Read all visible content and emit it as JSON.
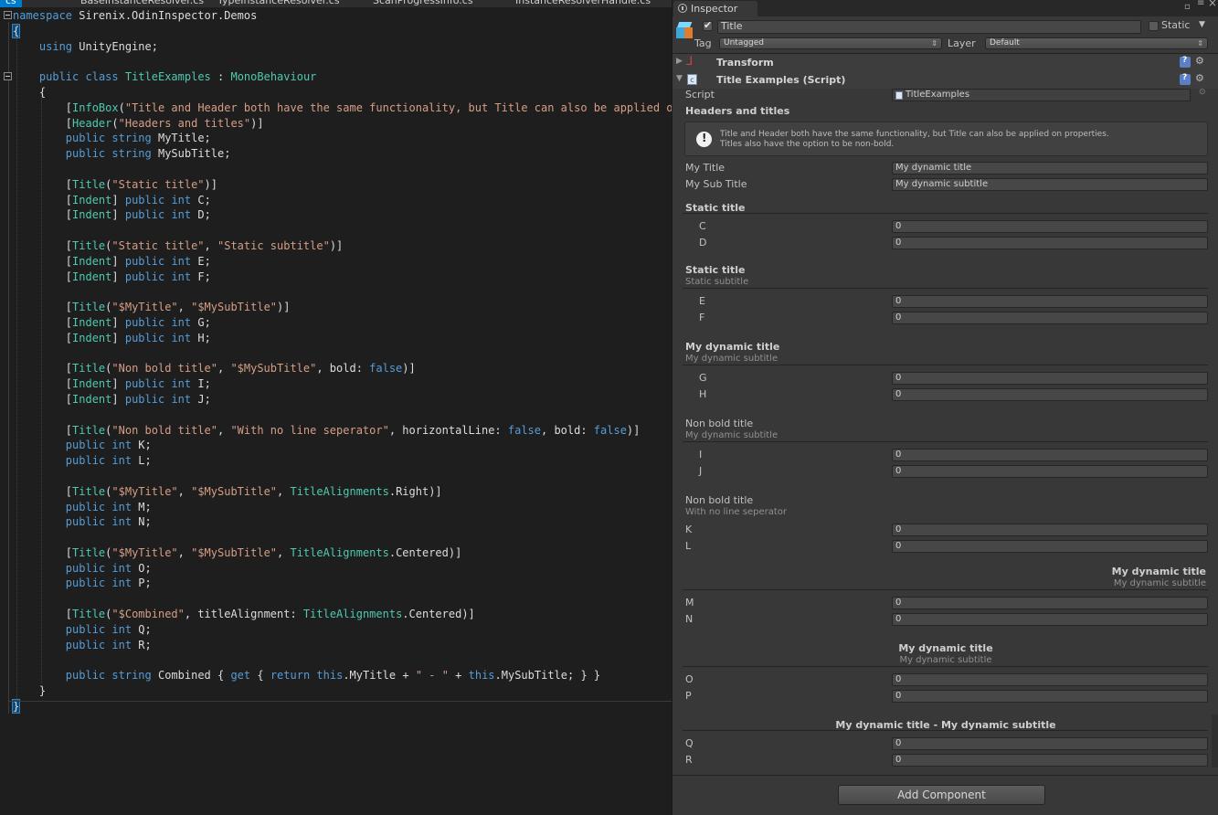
{
  "editor": {
    "tabs": [
      "cs",
      "BaseInstanceResolver.cs",
      "TypeInstanceResolver.cs",
      "ScanProgressInfo.cs",
      "InstanceResolverHandle.cs"
    ],
    "lines": [
      [
        [
          "kw",
          "namespace"
        ],
        [
          "pl",
          " Sirenix.OdinInspector.Demos"
        ]
      ],
      [
        [
          "pl",
          "{"
        ]
      ],
      [
        [
          "pl",
          "    "
        ],
        [
          "kw",
          "using"
        ],
        [
          "pl",
          " UnityEngine;"
        ]
      ],
      [
        [
          "pl",
          ""
        ]
      ],
      [
        [
          "pl",
          "    "
        ],
        [
          "kw",
          "public"
        ],
        [
          "pl",
          " "
        ],
        [
          "kw",
          "class"
        ],
        [
          "pl",
          " "
        ],
        [
          "ty",
          "TitleExamples"
        ],
        [
          "pl",
          " : "
        ],
        [
          "ty",
          "MonoBehaviour"
        ]
      ],
      [
        [
          "pl",
          "    {"
        ]
      ],
      [
        [
          "pl",
          "        ["
        ],
        [
          "ty",
          "InfoBox"
        ],
        [
          "pl",
          "("
        ],
        [
          "st",
          "\"Title and Header both have the same functionality, but Title can also be applied on"
        ]
      ],
      [
        [
          "pl",
          "        ["
        ],
        [
          "ty",
          "Header"
        ],
        [
          "pl",
          "("
        ],
        [
          "st",
          "\"Headers and titles\""
        ],
        [
          "pl",
          ")]"
        ]
      ],
      [
        [
          "pl",
          "        "
        ],
        [
          "kw",
          "public"
        ],
        [
          "pl",
          " "
        ],
        [
          "kw",
          "string"
        ],
        [
          "pl",
          " MyTitle;"
        ]
      ],
      [
        [
          "pl",
          "        "
        ],
        [
          "kw",
          "public"
        ],
        [
          "pl",
          " "
        ],
        [
          "kw",
          "string"
        ],
        [
          "pl",
          " MySubTitle;"
        ]
      ],
      [
        [
          "pl",
          ""
        ]
      ],
      [
        [
          "pl",
          "        ["
        ],
        [
          "ty",
          "Title"
        ],
        [
          "pl",
          "("
        ],
        [
          "st",
          "\"Static title\""
        ],
        [
          "pl",
          ")]"
        ]
      ],
      [
        [
          "pl",
          "        ["
        ],
        [
          "ty",
          "Indent"
        ],
        [
          "pl",
          "] "
        ],
        [
          "kw",
          "public"
        ],
        [
          "pl",
          " "
        ],
        [
          "kw",
          "int"
        ],
        [
          "pl",
          " C;"
        ]
      ],
      [
        [
          "pl",
          "        ["
        ],
        [
          "ty",
          "Indent"
        ],
        [
          "pl",
          "] "
        ],
        [
          "kw",
          "public"
        ],
        [
          "pl",
          " "
        ],
        [
          "kw",
          "int"
        ],
        [
          "pl",
          " D;"
        ]
      ],
      [
        [
          "pl",
          ""
        ]
      ],
      [
        [
          "pl",
          "        ["
        ],
        [
          "ty",
          "Title"
        ],
        [
          "pl",
          "("
        ],
        [
          "st",
          "\"Static title\""
        ],
        [
          "pl",
          ", "
        ],
        [
          "st",
          "\"Static subtitle\""
        ],
        [
          "pl",
          ")]"
        ]
      ],
      [
        [
          "pl",
          "        ["
        ],
        [
          "ty",
          "Indent"
        ],
        [
          "pl",
          "] "
        ],
        [
          "kw",
          "public"
        ],
        [
          "pl",
          " "
        ],
        [
          "kw",
          "int"
        ],
        [
          "pl",
          " E;"
        ]
      ],
      [
        [
          "pl",
          "        ["
        ],
        [
          "ty",
          "Indent"
        ],
        [
          "pl",
          "] "
        ],
        [
          "kw",
          "public"
        ],
        [
          "pl",
          " "
        ],
        [
          "kw",
          "int"
        ],
        [
          "pl",
          " F;"
        ]
      ],
      [
        [
          "pl",
          ""
        ]
      ],
      [
        [
          "pl",
          "        ["
        ],
        [
          "ty",
          "Title"
        ],
        [
          "pl",
          "("
        ],
        [
          "st",
          "\"$MyTitle\""
        ],
        [
          "pl",
          ", "
        ],
        [
          "st",
          "\"$MySubTitle\""
        ],
        [
          "pl",
          ")]"
        ]
      ],
      [
        [
          "pl",
          "        ["
        ],
        [
          "ty",
          "Indent"
        ],
        [
          "pl",
          "] "
        ],
        [
          "kw",
          "public"
        ],
        [
          "pl",
          " "
        ],
        [
          "kw",
          "int"
        ],
        [
          "pl",
          " G;"
        ]
      ],
      [
        [
          "pl",
          "        ["
        ],
        [
          "ty",
          "Indent"
        ],
        [
          "pl",
          "] "
        ],
        [
          "kw",
          "public"
        ],
        [
          "pl",
          " "
        ],
        [
          "kw",
          "int"
        ],
        [
          "pl",
          " H;"
        ]
      ],
      [
        [
          "pl",
          ""
        ]
      ],
      [
        [
          "pl",
          "        ["
        ],
        [
          "ty",
          "Title"
        ],
        [
          "pl",
          "("
        ],
        [
          "st",
          "\"Non bold title\""
        ],
        [
          "pl",
          ", "
        ],
        [
          "st",
          "\"$MySubTitle\""
        ],
        [
          "pl",
          ", bold: "
        ],
        [
          "kw",
          "false"
        ],
        [
          "pl",
          ")]"
        ]
      ],
      [
        [
          "pl",
          "        ["
        ],
        [
          "ty",
          "Indent"
        ],
        [
          "pl",
          "] "
        ],
        [
          "kw",
          "public"
        ],
        [
          "pl",
          " "
        ],
        [
          "kw",
          "int"
        ],
        [
          "pl",
          " I;"
        ]
      ],
      [
        [
          "pl",
          "        ["
        ],
        [
          "ty",
          "Indent"
        ],
        [
          "pl",
          "] "
        ],
        [
          "kw",
          "public"
        ],
        [
          "pl",
          " "
        ],
        [
          "kw",
          "int"
        ],
        [
          "pl",
          " J;"
        ]
      ],
      [
        [
          "pl",
          ""
        ]
      ],
      [
        [
          "pl",
          "        ["
        ],
        [
          "ty",
          "Title"
        ],
        [
          "pl",
          "("
        ],
        [
          "st",
          "\"Non bold title\""
        ],
        [
          "pl",
          ", "
        ],
        [
          "st",
          "\"With no line seperator\""
        ],
        [
          "pl",
          ", horizontalLine: "
        ],
        [
          "kw",
          "false"
        ],
        [
          "pl",
          ", bold: "
        ],
        [
          "kw",
          "false"
        ],
        [
          "pl",
          ")]"
        ]
      ],
      [
        [
          "pl",
          "        "
        ],
        [
          "kw",
          "public"
        ],
        [
          "pl",
          " "
        ],
        [
          "kw",
          "int"
        ],
        [
          "pl",
          " K;"
        ]
      ],
      [
        [
          "pl",
          "        "
        ],
        [
          "kw",
          "public"
        ],
        [
          "pl",
          " "
        ],
        [
          "kw",
          "int"
        ],
        [
          "pl",
          " L;"
        ]
      ],
      [
        [
          "pl",
          ""
        ]
      ],
      [
        [
          "pl",
          "        ["
        ],
        [
          "ty",
          "Title"
        ],
        [
          "pl",
          "("
        ],
        [
          "st",
          "\"$MyTitle\""
        ],
        [
          "pl",
          ", "
        ],
        [
          "st",
          "\"$MySubTitle\""
        ],
        [
          "pl",
          ", "
        ],
        [
          "ty",
          "TitleAlignments"
        ],
        [
          "pl",
          ".Right)]"
        ]
      ],
      [
        [
          "pl",
          "        "
        ],
        [
          "kw",
          "public"
        ],
        [
          "pl",
          " "
        ],
        [
          "kw",
          "int"
        ],
        [
          "pl",
          " M;"
        ]
      ],
      [
        [
          "pl",
          "        "
        ],
        [
          "kw",
          "public"
        ],
        [
          "pl",
          " "
        ],
        [
          "kw",
          "int"
        ],
        [
          "pl",
          " N;"
        ]
      ],
      [
        [
          "pl",
          ""
        ]
      ],
      [
        [
          "pl",
          "        ["
        ],
        [
          "ty",
          "Title"
        ],
        [
          "pl",
          "("
        ],
        [
          "st",
          "\"$MyTitle\""
        ],
        [
          "pl",
          ", "
        ],
        [
          "st",
          "\"$MySubTitle\""
        ],
        [
          "pl",
          ", "
        ],
        [
          "ty",
          "TitleAlignments"
        ],
        [
          "pl",
          ".Centered)]"
        ]
      ],
      [
        [
          "pl",
          "        "
        ],
        [
          "kw",
          "public"
        ],
        [
          "pl",
          " "
        ],
        [
          "kw",
          "int"
        ],
        [
          "pl",
          " O;"
        ]
      ],
      [
        [
          "pl",
          "        "
        ],
        [
          "kw",
          "public"
        ],
        [
          "pl",
          " "
        ],
        [
          "kw",
          "int"
        ],
        [
          "pl",
          " P;"
        ]
      ],
      [
        [
          "pl",
          ""
        ]
      ],
      [
        [
          "pl",
          "        ["
        ],
        [
          "ty",
          "Title"
        ],
        [
          "pl",
          "("
        ],
        [
          "st",
          "\"$Combined\""
        ],
        [
          "pl",
          ", titleAlignment: "
        ],
        [
          "ty",
          "TitleAlignments"
        ],
        [
          "pl",
          ".Centered)]"
        ]
      ],
      [
        [
          "pl",
          "        "
        ],
        [
          "kw",
          "public"
        ],
        [
          "pl",
          " "
        ],
        [
          "kw",
          "int"
        ],
        [
          "pl",
          " Q;"
        ]
      ],
      [
        [
          "pl",
          "        "
        ],
        [
          "kw",
          "public"
        ],
        [
          "pl",
          " "
        ],
        [
          "kw",
          "int"
        ],
        [
          "pl",
          " R;"
        ]
      ],
      [
        [
          "pl",
          ""
        ]
      ],
      [
        [
          "pl",
          "        "
        ],
        [
          "kw",
          "public"
        ],
        [
          "pl",
          " "
        ],
        [
          "kw",
          "string"
        ],
        [
          "pl",
          " Combined { "
        ],
        [
          "kw",
          "get"
        ],
        [
          "pl",
          " { "
        ],
        [
          "kw",
          "return"
        ],
        [
          "pl",
          " "
        ],
        [
          "kw",
          "this"
        ],
        [
          "pl",
          ".MyTitle + "
        ],
        [
          "st",
          "\" - \""
        ],
        [
          "pl",
          " + "
        ],
        [
          "kw",
          "this"
        ],
        [
          "pl",
          ".MySubTitle; } }"
        ]
      ],
      [
        [
          "pl",
          "    }"
        ]
      ],
      [
        [
          "pl",
          "}"
        ]
      ]
    ]
  },
  "inspector": {
    "tab_label": "Inspector",
    "object_name": "Title",
    "static_label": "Static",
    "tag_label": "Tag",
    "tag_value": "Untagged",
    "layer_label": "Layer",
    "layer_value": "Default",
    "transform_label": "Transform",
    "component_label": "Title Examples (Script)",
    "script_label": "Script",
    "script_value": "TitleExamples",
    "header_text": "Headers and titles",
    "infobox_line1": "Title and Header both have the same functionality, but Title can also be applied on properties.",
    "infobox_line2": "Titles also have the option to be non-bold.",
    "my_title_label": "My Title",
    "my_title_value": "My dynamic title",
    "my_subtitle_label": "My Sub Title",
    "my_subtitle_value": "My dynamic subtitle",
    "add_component": "Add Component",
    "groups": [
      {
        "title": "Static title",
        "subtitle": "",
        "bold": true,
        "align": "left",
        "line": true,
        "indent": true,
        "fields": [
          {
            "label": "C",
            "value": "0"
          },
          {
            "label": "D",
            "value": "0"
          }
        ]
      },
      {
        "title": "Static title",
        "subtitle": "Static subtitle",
        "bold": true,
        "align": "left",
        "line": true,
        "indent": true,
        "fields": [
          {
            "label": "E",
            "value": "0"
          },
          {
            "label": "F",
            "value": "0"
          }
        ]
      },
      {
        "title": "My dynamic title",
        "subtitle": "My dynamic subtitle",
        "bold": true,
        "align": "left",
        "line": true,
        "indent": true,
        "fields": [
          {
            "label": "G",
            "value": "0"
          },
          {
            "label": "H",
            "value": "0"
          }
        ]
      },
      {
        "title": "Non bold title",
        "subtitle": "My dynamic subtitle",
        "bold": false,
        "align": "left",
        "line": true,
        "indent": true,
        "fields": [
          {
            "label": "I",
            "value": "0"
          },
          {
            "label": "J",
            "value": "0"
          }
        ]
      },
      {
        "title": "Non bold title",
        "subtitle": "With no line seperator",
        "bold": false,
        "align": "left",
        "line": false,
        "indent": false,
        "fields": [
          {
            "label": "K",
            "value": "0"
          },
          {
            "label": "L",
            "value": "0"
          }
        ]
      },
      {
        "title": "My dynamic title",
        "subtitle": "My dynamic subtitle",
        "bold": true,
        "align": "right",
        "line": true,
        "indent": false,
        "fields": [
          {
            "label": "M",
            "value": "0"
          },
          {
            "label": "N",
            "value": "0"
          }
        ]
      },
      {
        "title": "My dynamic title",
        "subtitle": "My dynamic subtitle",
        "bold": true,
        "align": "center",
        "line": true,
        "indent": false,
        "fields": [
          {
            "label": "O",
            "value": "0"
          },
          {
            "label": "P",
            "value": "0"
          }
        ]
      },
      {
        "title": "My dynamic title - My dynamic subtitle",
        "subtitle": "",
        "bold": true,
        "align": "center",
        "line": true,
        "indent": false,
        "fields": [
          {
            "label": "Q",
            "value": "0"
          },
          {
            "label": "R",
            "value": "0"
          }
        ]
      }
    ]
  }
}
